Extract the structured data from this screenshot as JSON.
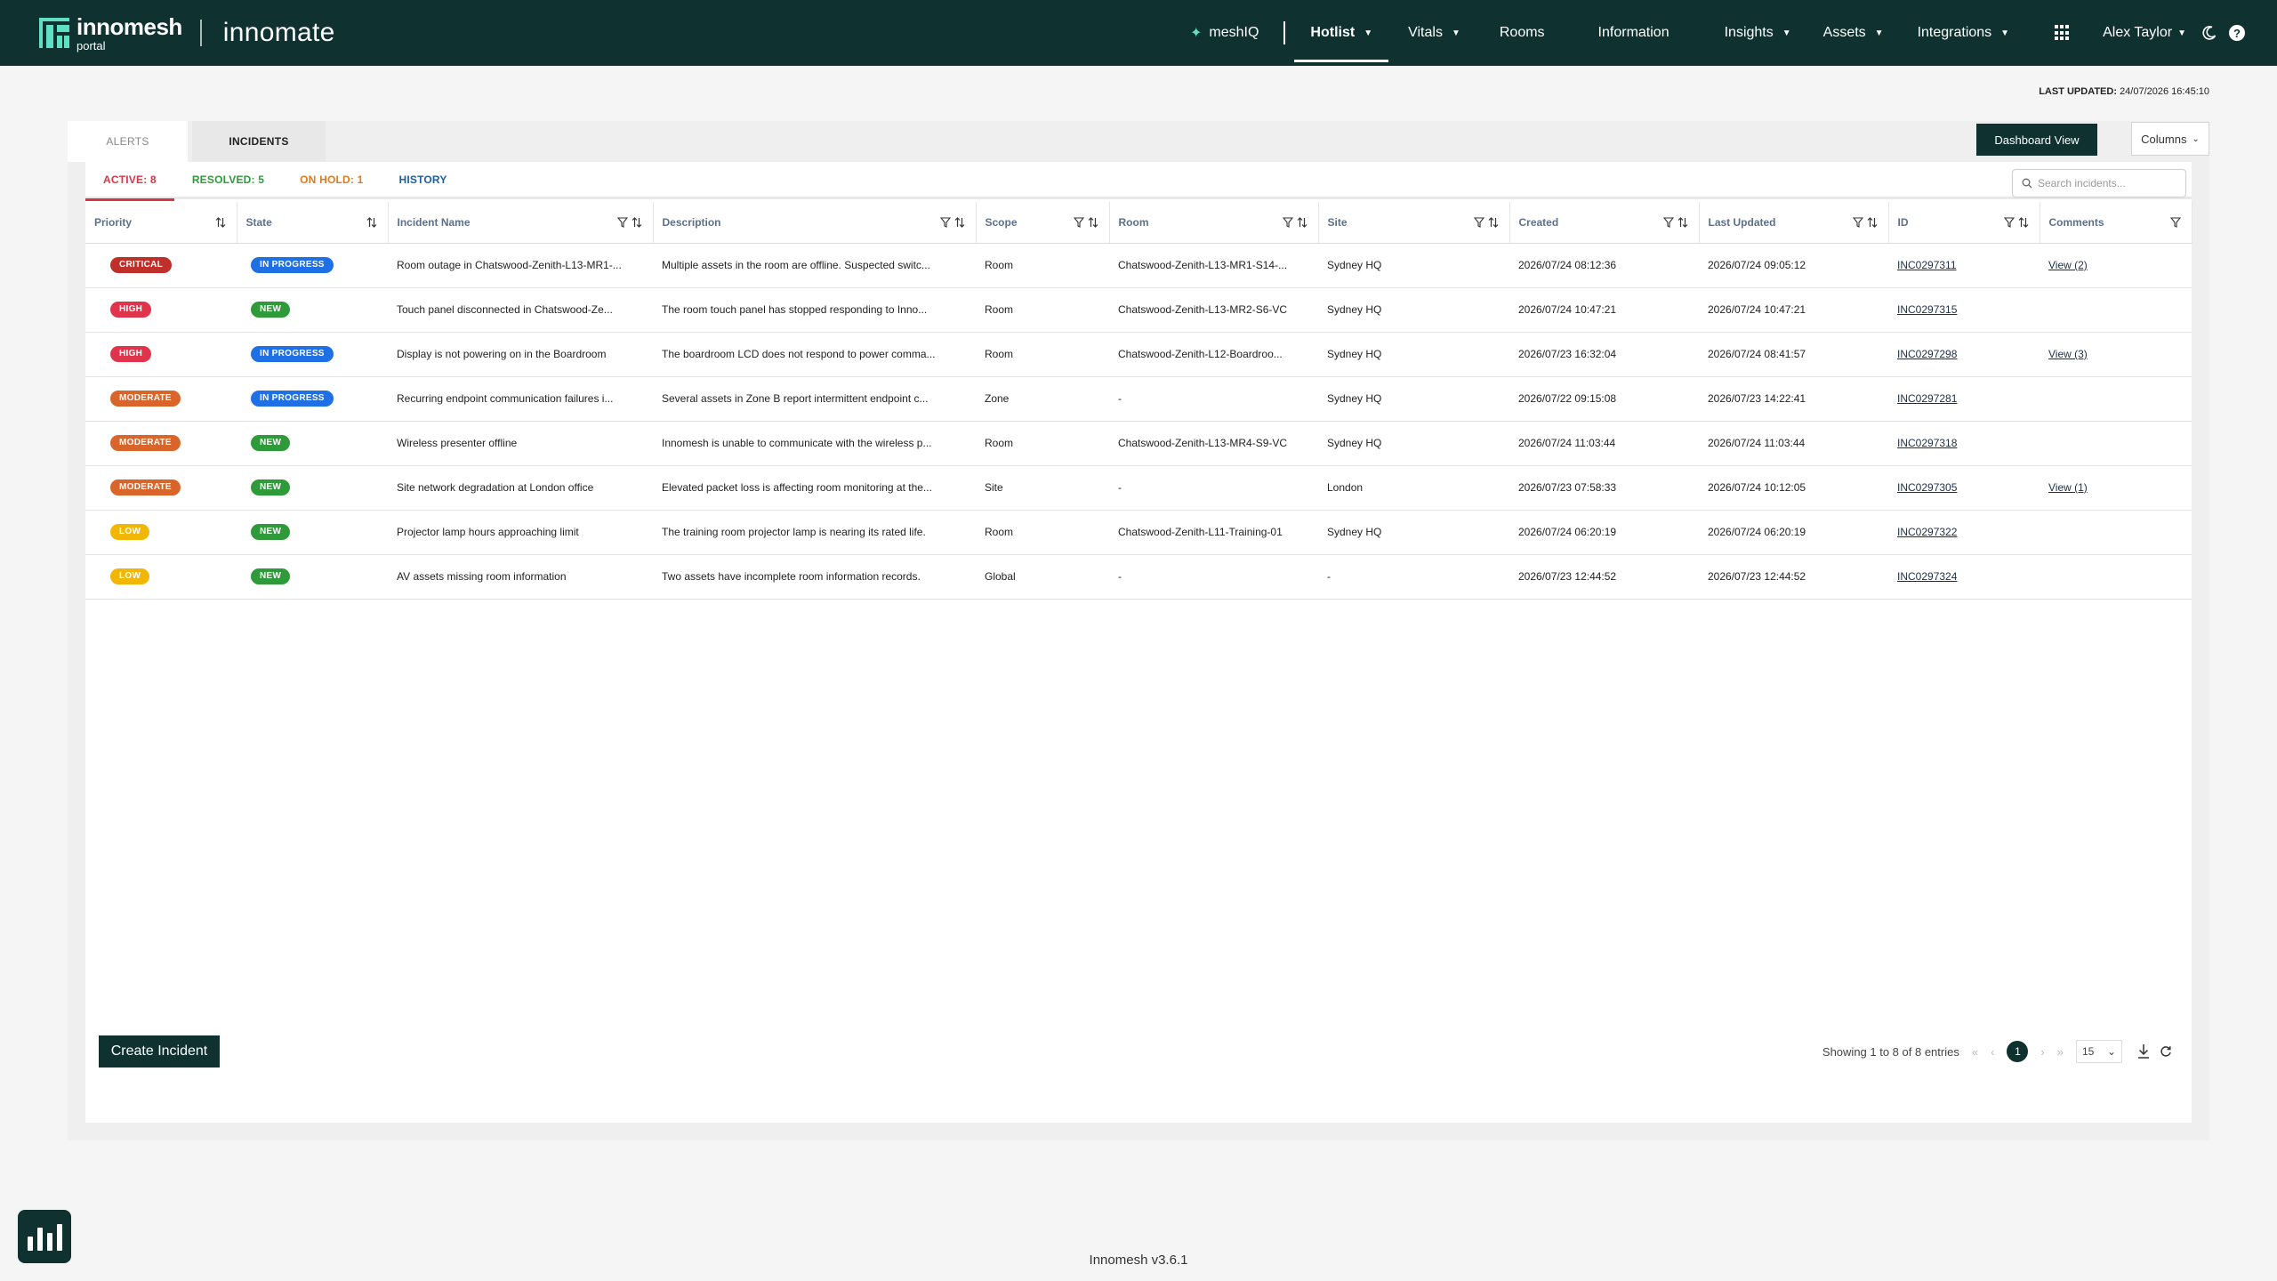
{
  "brand": {
    "name": "innomesh",
    "sub": "portal",
    "app": "innomate"
  },
  "nav": {
    "meshiq": "meshIQ",
    "items": [
      {
        "label": "Hotlist",
        "caret": true,
        "active": true
      },
      {
        "label": "Vitals",
        "caret": true
      },
      {
        "label": "Rooms",
        "caret": false
      },
      {
        "label": "Information",
        "caret": false
      },
      {
        "label": "Insights",
        "caret": true
      },
      {
        "label": "Assets",
        "caret": true
      },
      {
        "label": "Integrations",
        "caret": true
      }
    ],
    "user": "Alex Taylor"
  },
  "last_updated": {
    "label": "LAST UPDATED:",
    "value": "24/07/2026 16:45:10"
  },
  "tabs": {
    "alerts": "ALERTS",
    "incidents": "INCIDENTS"
  },
  "toolbar": {
    "dashboard": "Dashboard View",
    "columns": "Columns"
  },
  "subtabs": {
    "active": "ACTIVE: 8",
    "resolved": "RESOLVED: 5",
    "hold": "ON HOLD: 1",
    "history": "HISTORY"
  },
  "search": {
    "placeholder": "Search incidents..."
  },
  "columns": [
    "Priority",
    "State",
    "Incident Name",
    "Description",
    "Scope",
    "Room",
    "Site",
    "Created",
    "Last Updated",
    "ID",
    "Comments"
  ],
  "colors": {
    "CRITICAL": "#c0302b",
    "HIGH": "#e0344c",
    "MODERATE": "#d9652a",
    "LOW": "#f2b705",
    "IN PROGRESS": "#1f6fe5",
    "NEW": "#2e9a3a"
  },
  "rows": [
    {
      "priority": "CRITICAL",
      "state": "IN PROGRESS",
      "name": "Room outage in Chatswood-Zenith-L13-MR1-...",
      "desc": "Multiple assets in the room are offline. Suspected switc...",
      "scope": "Room",
      "room": "Chatswood-Zenith-L13-MR1-S14-...",
      "site": "Sydney HQ",
      "created": "2026/07/24 08:12:36",
      "updated": "2026/07/24 09:05:12",
      "id": "INC0297311",
      "comments": "View (2)"
    },
    {
      "priority": "HIGH",
      "state": "NEW",
      "name": "Touch panel disconnected in Chatswood-Ze...",
      "desc": "The room touch panel has stopped responding to Inno...",
      "scope": "Room",
      "room": "Chatswood-Zenith-L13-MR2-S6-VC",
      "site": "Sydney HQ",
      "created": "2026/07/24 10:47:21",
      "updated": "2026/07/24 10:47:21",
      "id": "INC0297315",
      "comments": ""
    },
    {
      "priority": "HIGH",
      "state": "IN PROGRESS",
      "name": "Display is not powering on in the Boardroom",
      "desc": "The boardroom LCD does not respond to power comma...",
      "scope": "Room",
      "room": "Chatswood-Zenith-L12-Boardroo...",
      "site": "Sydney HQ",
      "created": "2026/07/23 16:32:04",
      "updated": "2026/07/24 08:41:57",
      "id": "INC0297298",
      "comments": "View (3)"
    },
    {
      "priority": "MODERATE",
      "state": "IN PROGRESS",
      "name": "Recurring endpoint communication failures i...",
      "desc": "Several assets in Zone B report intermittent endpoint c...",
      "scope": "Zone",
      "room": "-",
      "site": "Sydney HQ",
      "created": "2026/07/22 09:15:08",
      "updated": "2026/07/23 14:22:41",
      "id": "INC0297281",
      "comments": ""
    },
    {
      "priority": "MODERATE",
      "state": "NEW",
      "name": "Wireless presenter offline",
      "desc": "Innomesh is unable to communicate with the wireless p...",
      "scope": "Room",
      "room": "Chatswood-Zenith-L13-MR4-S9-VC",
      "site": "Sydney HQ",
      "created": "2026/07/24 11:03:44",
      "updated": "2026/07/24 11:03:44",
      "id": "INC0297318",
      "comments": ""
    },
    {
      "priority": "MODERATE",
      "state": "NEW",
      "name": "Site network degradation at London office",
      "desc": "Elevated packet loss is affecting room monitoring at the...",
      "scope": "Site",
      "room": "-",
      "site": "London",
      "created": "2026/07/23 07:58:33",
      "updated": "2026/07/24 10:12:05",
      "id": "INC0297305",
      "comments": "View (1)"
    },
    {
      "priority": "LOW",
      "state": "NEW",
      "name": "Projector lamp hours approaching limit",
      "desc": "The training room projector lamp is nearing its rated life.",
      "scope": "Room",
      "room": "Chatswood-Zenith-L11-Training-01",
      "site": "Sydney HQ",
      "created": "2026/07/24 06:20:19",
      "updated": "2026/07/24 06:20:19",
      "id": "INC0297322",
      "comments": ""
    },
    {
      "priority": "LOW",
      "state": "NEW",
      "name": "AV assets missing room information",
      "desc": "Two assets have incomplete room information records.",
      "scope": "Global",
      "room": "-",
      "site": "-",
      "created": "2026/07/23 12:44:52",
      "updated": "2026/07/23 12:44:52",
      "id": "INC0297324",
      "comments": ""
    }
  ],
  "footer_actions": {
    "create": "Create Incident",
    "showing": "Showing 1 to 8 of 8 entries",
    "page": "1",
    "page_size": "15"
  },
  "version": "Innomesh v3.6.1"
}
